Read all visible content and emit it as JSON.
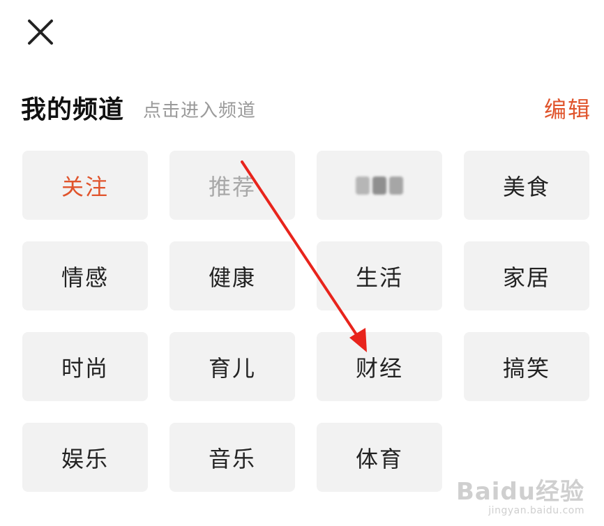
{
  "header": {
    "title": "我的频道",
    "subtitle": "点击进入频道",
    "edit_label": "编辑"
  },
  "channels": [
    {
      "label": "关注",
      "state": "selected"
    },
    {
      "label": "推荐",
      "state": "fixed"
    },
    {
      "label": "",
      "state": "obscured"
    },
    {
      "label": "美食"
    },
    {
      "label": "情感"
    },
    {
      "label": "健康"
    },
    {
      "label": "生活"
    },
    {
      "label": "家居"
    },
    {
      "label": "时尚"
    },
    {
      "label": "育儿"
    },
    {
      "label": "财经"
    },
    {
      "label": "搞笑"
    },
    {
      "label": "娱乐"
    },
    {
      "label": "音乐"
    },
    {
      "label": "体育"
    }
  ],
  "icons": {
    "close": "close-icon"
  },
  "colors": {
    "accent": "#e0542c",
    "tile_bg": "#f2f2f2",
    "text": "#222222",
    "muted": "#a8a8a8",
    "annotation_arrow": "#e8241c"
  },
  "watermark": {
    "logo": "Baidu经验",
    "url": "jingyan.baidu.com"
  }
}
